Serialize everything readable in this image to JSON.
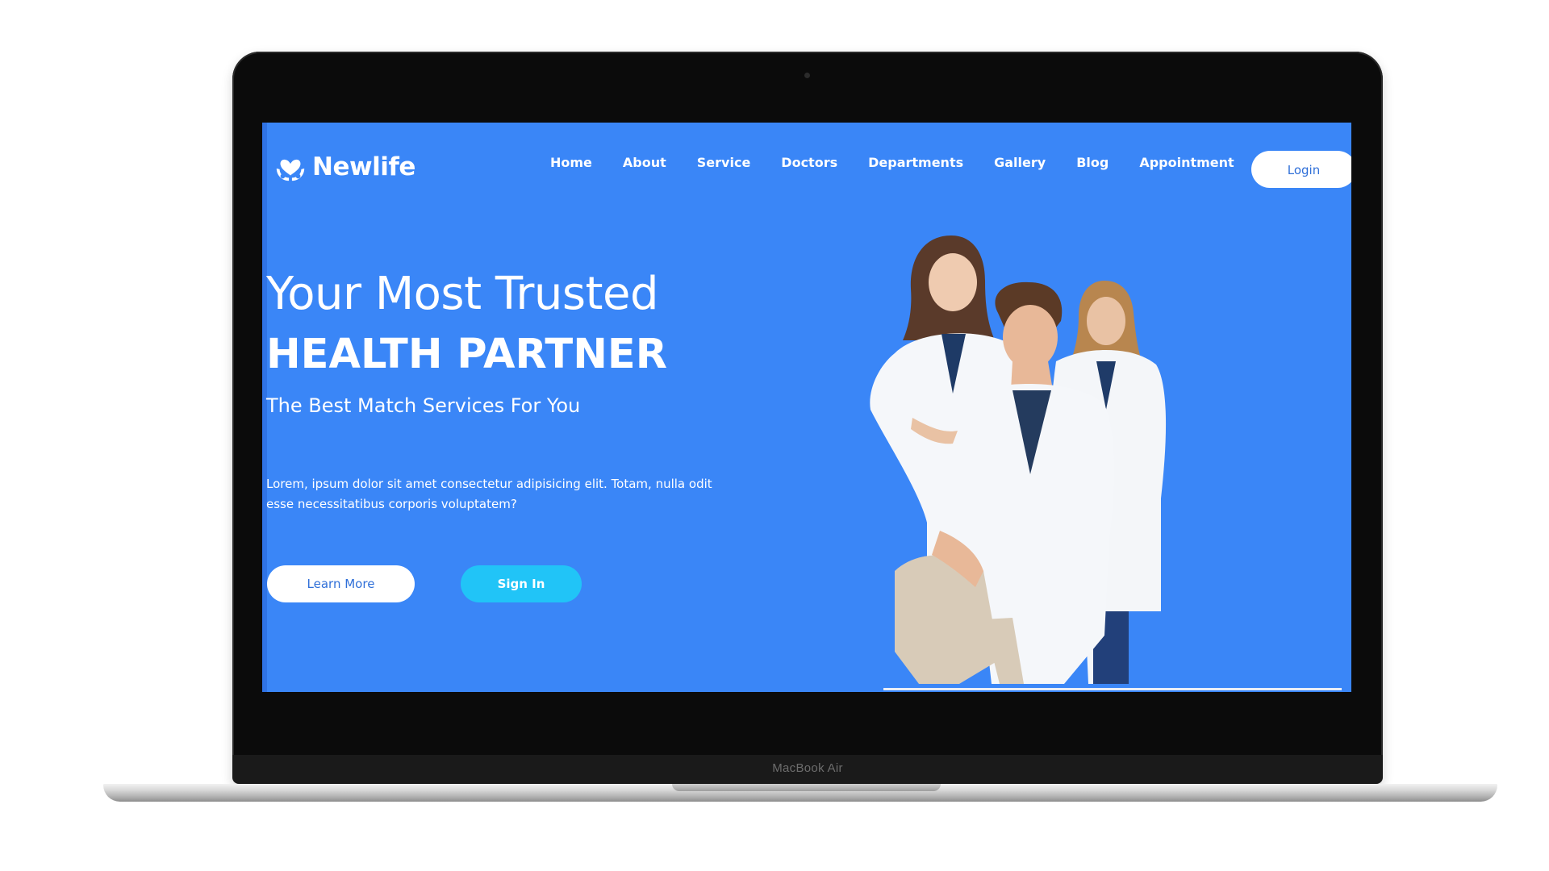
{
  "device": {
    "brand_label": "MacBook Air"
  },
  "site": {
    "logo_text": "Newlife",
    "nav": [
      {
        "label": "Home"
      },
      {
        "label": "About"
      },
      {
        "label": "Service"
      },
      {
        "label": "Doctors"
      },
      {
        "label": "Departments"
      },
      {
        "label": "Gallery"
      },
      {
        "label": "Blog"
      },
      {
        "label": "Appointment"
      }
    ],
    "login_label": "Login"
  },
  "hero": {
    "line1": "Your Most Trusted",
    "line2": "HEALTH PARTNER",
    "subtitle": "The Best Match Services For You",
    "description": "Lorem, ipsum dolor sit amet consectetur adipisicing elit. Totam, nulla odit esse necessitatibus corporis voluptatem?",
    "learn_more_label": "Learn More",
    "sign_in_label": "Sign In"
  },
  "colors": {
    "screen_bg": "#3a86f7",
    "accent_button": "#21c4f7",
    "text_on_white": "#2f6fd8"
  },
  "icons": {
    "logo": "heart-hands-icon"
  }
}
